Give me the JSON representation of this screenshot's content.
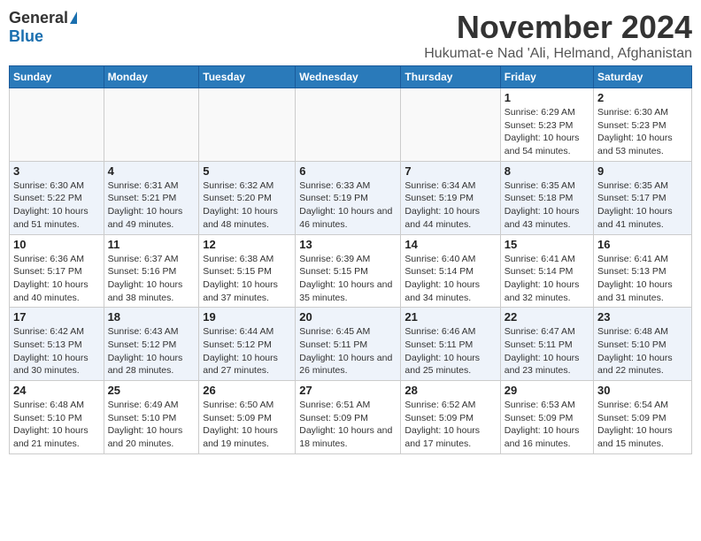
{
  "header": {
    "logo_general": "General",
    "logo_blue": "Blue",
    "month_title": "November 2024",
    "subtitle": "Hukumat-e Nad 'Ali, Helmand, Afghanistan"
  },
  "days_of_week": [
    "Sunday",
    "Monday",
    "Tuesday",
    "Wednesday",
    "Thursday",
    "Friday",
    "Saturday"
  ],
  "weeks": [
    [
      {
        "day": "",
        "empty": true
      },
      {
        "day": "",
        "empty": true
      },
      {
        "day": "",
        "empty": true
      },
      {
        "day": "",
        "empty": true
      },
      {
        "day": "",
        "empty": true
      },
      {
        "day": "1",
        "sunrise": "Sunrise: 6:29 AM",
        "sunset": "Sunset: 5:23 PM",
        "daylight": "Daylight: 10 hours and 54 minutes."
      },
      {
        "day": "2",
        "sunrise": "Sunrise: 6:30 AM",
        "sunset": "Sunset: 5:23 PM",
        "daylight": "Daylight: 10 hours and 53 minutes."
      }
    ],
    [
      {
        "day": "3",
        "sunrise": "Sunrise: 6:30 AM",
        "sunset": "Sunset: 5:22 PM",
        "daylight": "Daylight: 10 hours and 51 minutes."
      },
      {
        "day": "4",
        "sunrise": "Sunrise: 6:31 AM",
        "sunset": "Sunset: 5:21 PM",
        "daylight": "Daylight: 10 hours and 49 minutes."
      },
      {
        "day": "5",
        "sunrise": "Sunrise: 6:32 AM",
        "sunset": "Sunset: 5:20 PM",
        "daylight": "Daylight: 10 hours and 48 minutes."
      },
      {
        "day": "6",
        "sunrise": "Sunrise: 6:33 AM",
        "sunset": "Sunset: 5:19 PM",
        "daylight": "Daylight: 10 hours and 46 minutes."
      },
      {
        "day": "7",
        "sunrise": "Sunrise: 6:34 AM",
        "sunset": "Sunset: 5:19 PM",
        "daylight": "Daylight: 10 hours and 44 minutes."
      },
      {
        "day": "8",
        "sunrise": "Sunrise: 6:35 AM",
        "sunset": "Sunset: 5:18 PM",
        "daylight": "Daylight: 10 hours and 43 minutes."
      },
      {
        "day": "9",
        "sunrise": "Sunrise: 6:35 AM",
        "sunset": "Sunset: 5:17 PM",
        "daylight": "Daylight: 10 hours and 41 minutes."
      }
    ],
    [
      {
        "day": "10",
        "sunrise": "Sunrise: 6:36 AM",
        "sunset": "Sunset: 5:17 PM",
        "daylight": "Daylight: 10 hours and 40 minutes."
      },
      {
        "day": "11",
        "sunrise": "Sunrise: 6:37 AM",
        "sunset": "Sunset: 5:16 PM",
        "daylight": "Daylight: 10 hours and 38 minutes."
      },
      {
        "day": "12",
        "sunrise": "Sunrise: 6:38 AM",
        "sunset": "Sunset: 5:15 PM",
        "daylight": "Daylight: 10 hours and 37 minutes."
      },
      {
        "day": "13",
        "sunrise": "Sunrise: 6:39 AM",
        "sunset": "Sunset: 5:15 PM",
        "daylight": "Daylight: 10 hours and 35 minutes."
      },
      {
        "day": "14",
        "sunrise": "Sunrise: 6:40 AM",
        "sunset": "Sunset: 5:14 PM",
        "daylight": "Daylight: 10 hours and 34 minutes."
      },
      {
        "day": "15",
        "sunrise": "Sunrise: 6:41 AM",
        "sunset": "Sunset: 5:14 PM",
        "daylight": "Daylight: 10 hours and 32 minutes."
      },
      {
        "day": "16",
        "sunrise": "Sunrise: 6:41 AM",
        "sunset": "Sunset: 5:13 PM",
        "daylight": "Daylight: 10 hours and 31 minutes."
      }
    ],
    [
      {
        "day": "17",
        "sunrise": "Sunrise: 6:42 AM",
        "sunset": "Sunset: 5:13 PM",
        "daylight": "Daylight: 10 hours and 30 minutes."
      },
      {
        "day": "18",
        "sunrise": "Sunrise: 6:43 AM",
        "sunset": "Sunset: 5:12 PM",
        "daylight": "Daylight: 10 hours and 28 minutes."
      },
      {
        "day": "19",
        "sunrise": "Sunrise: 6:44 AM",
        "sunset": "Sunset: 5:12 PM",
        "daylight": "Daylight: 10 hours and 27 minutes."
      },
      {
        "day": "20",
        "sunrise": "Sunrise: 6:45 AM",
        "sunset": "Sunset: 5:11 PM",
        "daylight": "Daylight: 10 hours and 26 minutes."
      },
      {
        "day": "21",
        "sunrise": "Sunrise: 6:46 AM",
        "sunset": "Sunset: 5:11 PM",
        "daylight": "Daylight: 10 hours and 25 minutes."
      },
      {
        "day": "22",
        "sunrise": "Sunrise: 6:47 AM",
        "sunset": "Sunset: 5:11 PM",
        "daylight": "Daylight: 10 hours and 23 minutes."
      },
      {
        "day": "23",
        "sunrise": "Sunrise: 6:48 AM",
        "sunset": "Sunset: 5:10 PM",
        "daylight": "Daylight: 10 hours and 22 minutes."
      }
    ],
    [
      {
        "day": "24",
        "sunrise": "Sunrise: 6:48 AM",
        "sunset": "Sunset: 5:10 PM",
        "daylight": "Daylight: 10 hours and 21 minutes."
      },
      {
        "day": "25",
        "sunrise": "Sunrise: 6:49 AM",
        "sunset": "Sunset: 5:10 PM",
        "daylight": "Daylight: 10 hours and 20 minutes."
      },
      {
        "day": "26",
        "sunrise": "Sunrise: 6:50 AM",
        "sunset": "Sunset: 5:09 PM",
        "daylight": "Daylight: 10 hours and 19 minutes."
      },
      {
        "day": "27",
        "sunrise": "Sunrise: 6:51 AM",
        "sunset": "Sunset: 5:09 PM",
        "daylight": "Daylight: 10 hours and 18 minutes."
      },
      {
        "day": "28",
        "sunrise": "Sunrise: 6:52 AM",
        "sunset": "Sunset: 5:09 PM",
        "daylight": "Daylight: 10 hours and 17 minutes."
      },
      {
        "day": "29",
        "sunrise": "Sunrise: 6:53 AM",
        "sunset": "Sunset: 5:09 PM",
        "daylight": "Daylight: 10 hours and 16 minutes."
      },
      {
        "day": "30",
        "sunrise": "Sunrise: 6:54 AM",
        "sunset": "Sunset: 5:09 PM",
        "daylight": "Daylight: 10 hours and 15 minutes."
      }
    ]
  ]
}
